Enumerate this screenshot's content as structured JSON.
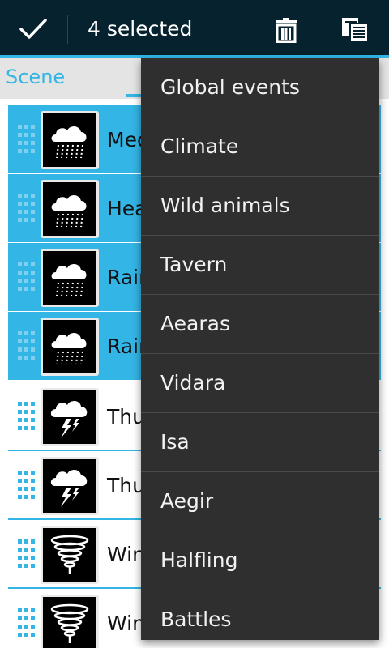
{
  "action_bar": {
    "done_icon": "check-icon",
    "selected_text": "4 selected",
    "delete_icon": "trash-icon",
    "copy_icon": "copy-icon",
    "accent_color": "#33b5e5",
    "bar_color": "#06222e"
  },
  "tabs": {
    "active_label": "Scene"
  },
  "list": {
    "items": [
      {
        "label": "Med",
        "icon": "rain-cloud-icon",
        "selected": true
      },
      {
        "label": "Hea",
        "icon": "rain-cloud-icon",
        "selected": true
      },
      {
        "label": "Rain",
        "icon": "rain-cloud-icon",
        "selected": true
      },
      {
        "label": "Rain",
        "icon": "rain-cloud-icon",
        "selected": true
      },
      {
        "label": "Thu",
        "icon": "thunder-cloud-icon",
        "selected": false
      },
      {
        "label": "Thu",
        "icon": "thunder-cloud-icon",
        "selected": false
      },
      {
        "label": "Win",
        "icon": "tornado-icon",
        "selected": false
      },
      {
        "label": "Win",
        "icon": "tornado-icon",
        "selected": false
      }
    ]
  },
  "popup_menu": {
    "items": [
      "Global events",
      "Climate",
      "Wild animals",
      "Tavern",
      "Aearas",
      "Vidara",
      "Isa",
      "Aegir",
      "Halfling",
      "Battles"
    ]
  }
}
